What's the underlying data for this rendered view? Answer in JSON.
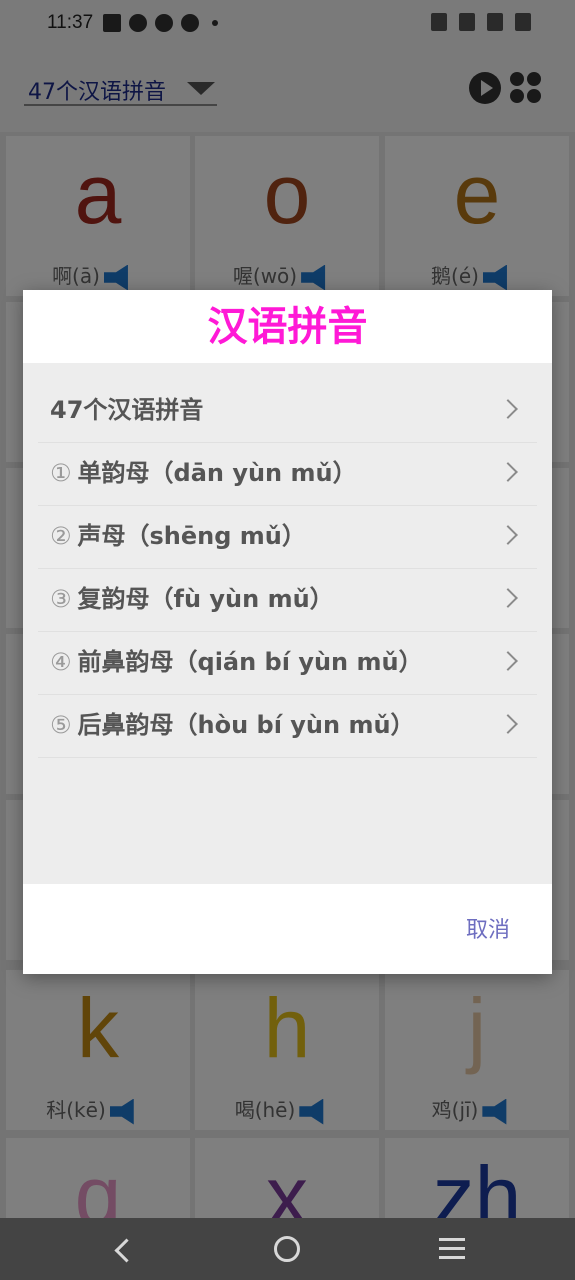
{
  "status_bar": {
    "time": "11:37"
  },
  "toolbar": {
    "dropdown_label": "47个汉语拼音"
  },
  "grid": {
    "cells": [
      {
        "letter": "a",
        "word": "啊(ā)",
        "color": "#a0281e"
      },
      {
        "letter": "o",
        "word": "喔(wō)",
        "color": "#a0461e"
      },
      {
        "letter": "e",
        "word": "鹅(é)",
        "color": "#b27418"
      },
      {
        "letter": "k",
        "word": "科(kē)",
        "color": "#c28a12"
      },
      {
        "letter": "h",
        "word": "喝(hē)",
        "color": "#e4c018"
      },
      {
        "letter": "j",
        "word": "鸡(jī)",
        "color": "#e6c8a6"
      },
      {
        "letter": "q",
        "word": "",
        "color": "#e898c8"
      },
      {
        "letter": "x",
        "word": "",
        "color": "#7a3a9a"
      },
      {
        "letter": "zh",
        "word": "",
        "color": "#1c3aa0"
      }
    ]
  },
  "dialog": {
    "title": "汉语拼音",
    "items": [
      {
        "num": "",
        "label": "47个汉语拼音"
      },
      {
        "num": "①",
        "label": "单韵母（dān yùn mǔ）"
      },
      {
        "num": "②",
        "label": "声母（shēng mǔ）"
      },
      {
        "num": "③",
        "label": "复韵母（fù yùn mǔ）"
      },
      {
        "num": "④",
        "label": "前鼻韵母（qián bí yùn mǔ）"
      },
      {
        "num": "⑤",
        "label": "后鼻韵母（hòu bí yùn mǔ）"
      }
    ],
    "cancel_label": "取消"
  }
}
